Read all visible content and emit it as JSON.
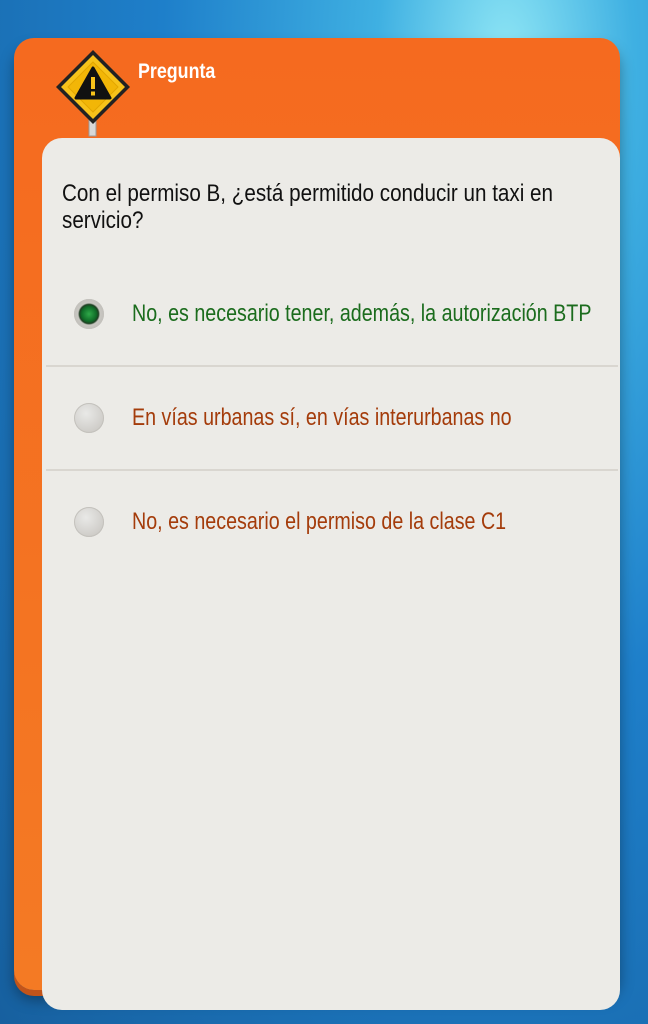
{
  "header": {
    "title": "Pregunta"
  },
  "question": {
    "text": "Con el permiso B, ¿está permitido conducir un taxi en servicio?"
  },
  "options": [
    {
      "label": "No, es necesario tener, además, la autorización BTP",
      "selected": true,
      "color": "#1b6c1d"
    },
    {
      "label": "En vías urbanas sí, en vías interurbanas no",
      "selected": false,
      "color": "#a43c0b"
    },
    {
      "label": "No, es necesario el permiso de la clase C1",
      "selected": false,
      "color": "#a43c0b"
    }
  ],
  "colors": {
    "card_orange": "#f56a1f",
    "panel": "#ecebe7",
    "background_blue": "#1e7fca"
  },
  "icons": {
    "header": "warning-sign-icon"
  }
}
